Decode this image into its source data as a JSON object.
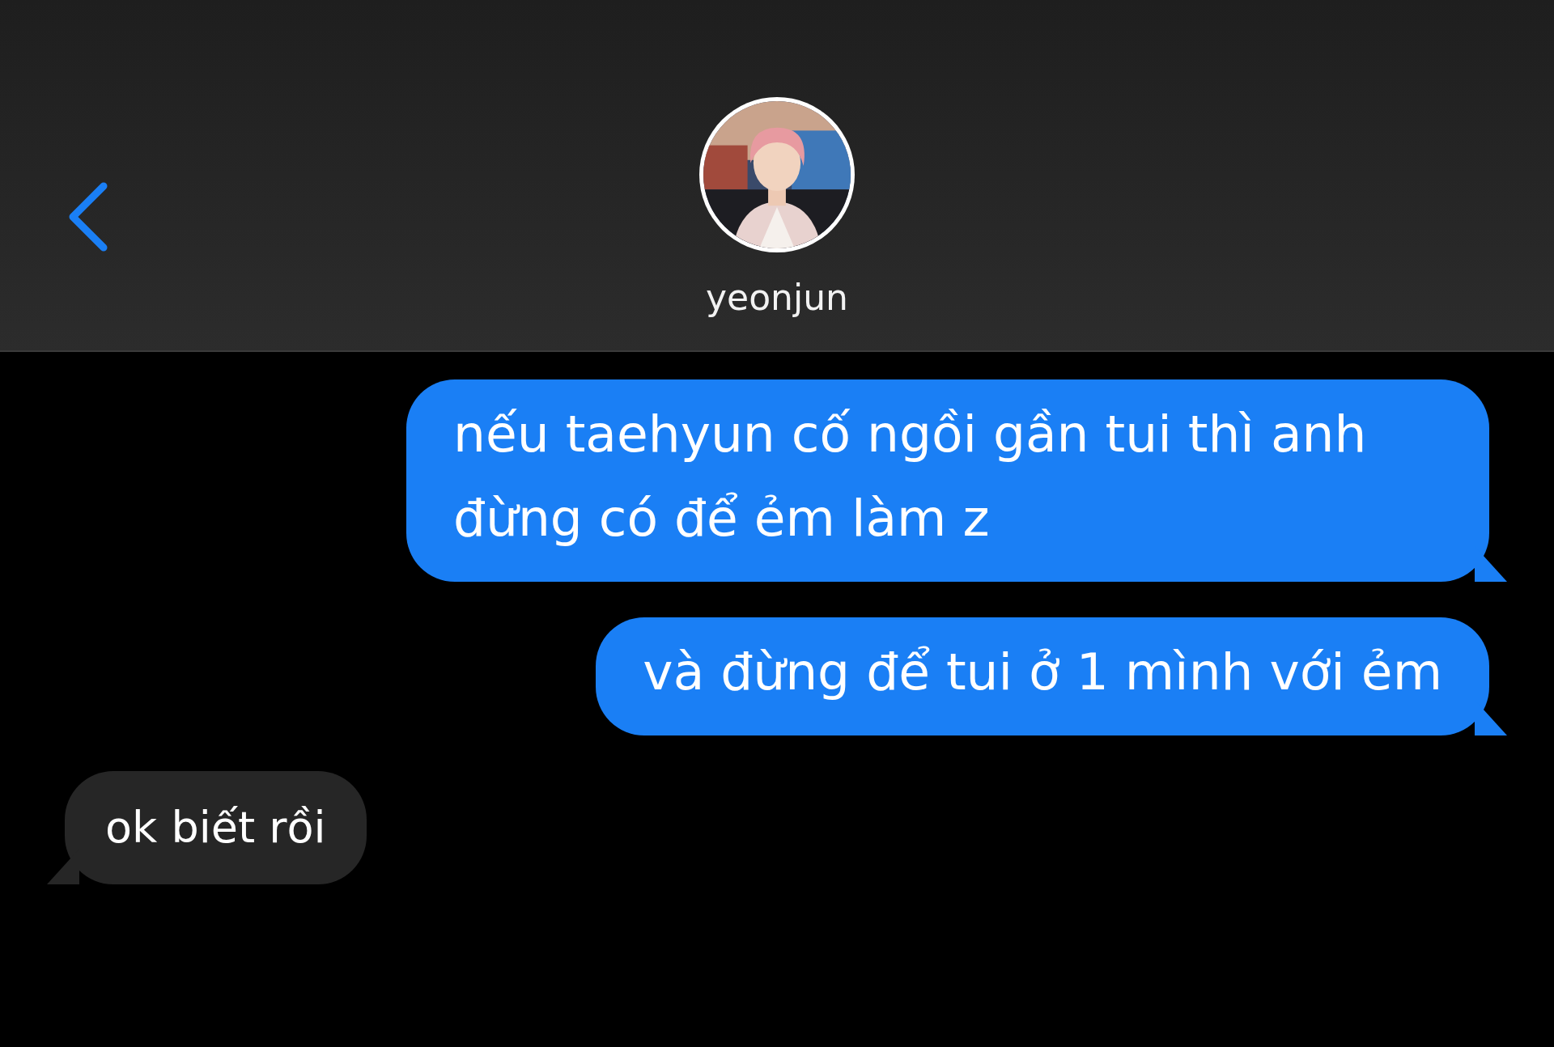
{
  "header": {
    "contact_name": "yeonjun"
  },
  "messages": [
    {
      "kind": "sent",
      "text": "nếu taehyun cố ngồi gần tui thì anh đừng có để ẻm làm z"
    },
    {
      "kind": "sent",
      "text": "và đừng để tui ở 1 mình với ẻm"
    },
    {
      "kind": "received",
      "text": "ok biết rồi"
    }
  ]
}
